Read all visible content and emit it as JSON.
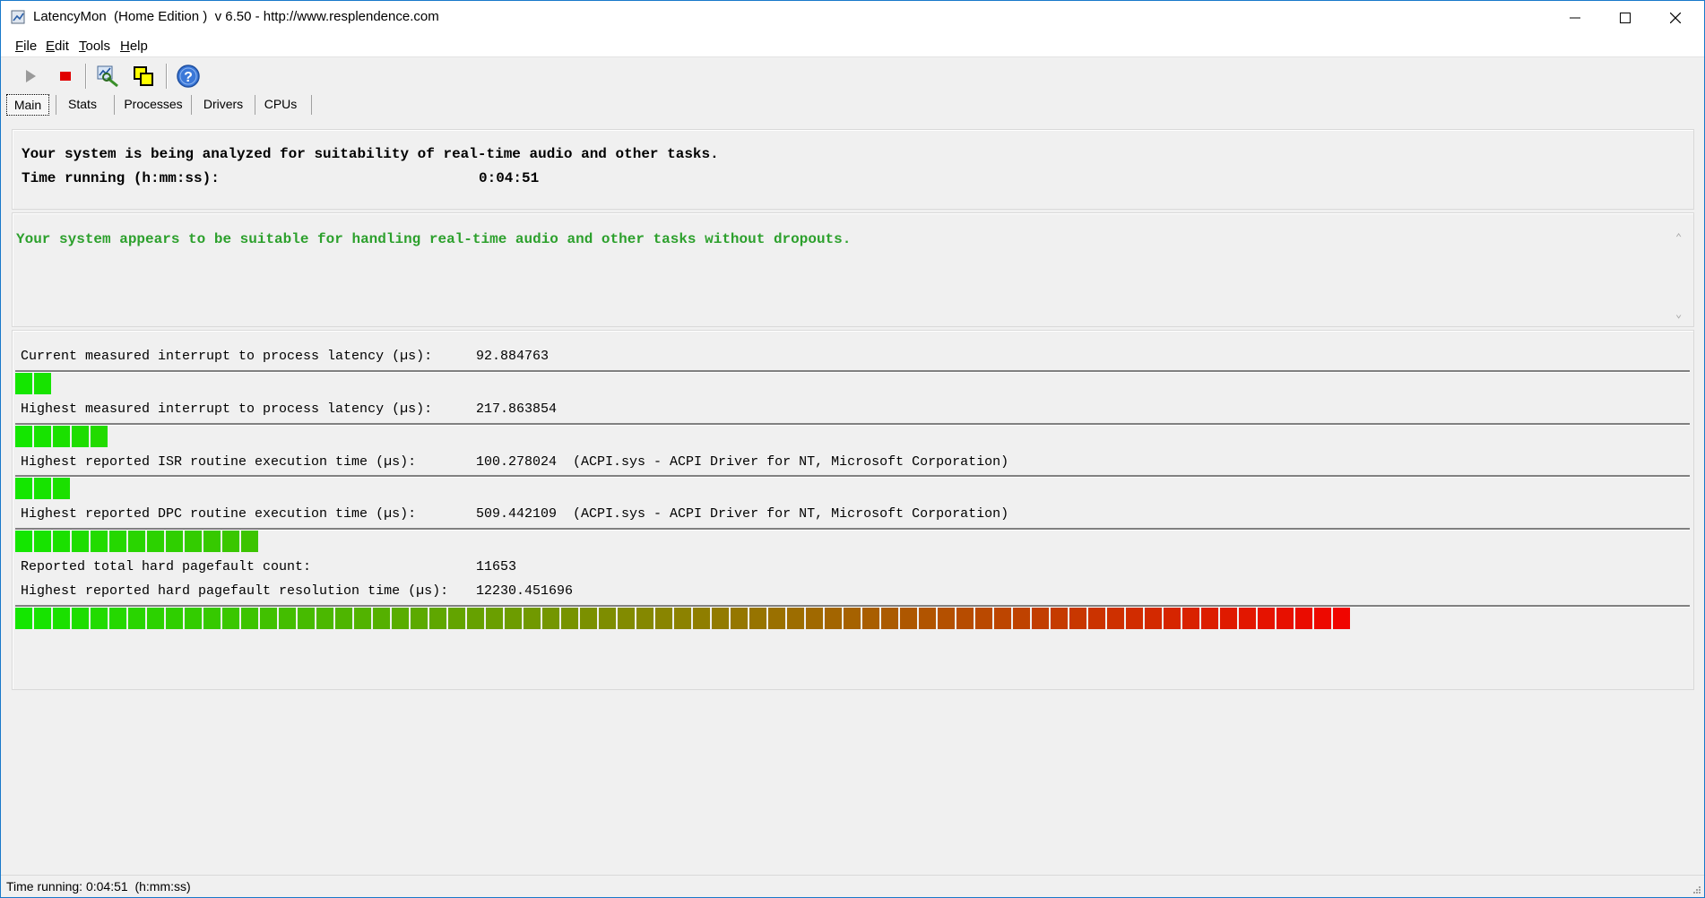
{
  "window": {
    "title": "LatencyMon  (Home Edition )  v 6.50 - http://www.resplendence.com"
  },
  "menu": {
    "items": [
      {
        "label": "File",
        "key": "F",
        "rest": "ile"
      },
      {
        "label": "Edit",
        "key": "E",
        "rest": "dit"
      },
      {
        "label": "Tools",
        "key": "T",
        "rest": "ools"
      },
      {
        "label": "Help",
        "key": "H",
        "rest": "elp"
      }
    ]
  },
  "toolbar": {
    "icons": [
      "play-icon",
      "stop-icon",
      "analyze-icon",
      "windows-icon",
      "help-icon"
    ]
  },
  "tabs": [
    {
      "label": "Main",
      "active": true
    },
    {
      "label": "Stats",
      "active": false
    },
    {
      "label": "Processes",
      "active": false
    },
    {
      "label": "Drivers",
      "active": false
    },
    {
      "label": "CPUs",
      "active": false
    }
  ],
  "summary": {
    "analyzing": "Your system is being analyzed for suitability of real-time audio and other tasks.",
    "time_label": "Time running (h:mm:ss):",
    "time_value": "0:04:51"
  },
  "verdict": {
    "message": "Your system appears to be suitable for handling real-time audio and other tasks without dropouts.",
    "color": "#2ca02c"
  },
  "metrics": [
    {
      "label": "Current measured interrupt to process latency (µs):",
      "value": "92.884763",
      "detail": "",
      "bar_segments": 2
    },
    {
      "label": "Highest measured interrupt to process latency (µs):",
      "value": "217.863854",
      "detail": "",
      "bar_segments": 5
    },
    {
      "label": "Highest reported ISR routine execution time (µs):",
      "value": "100.278024",
      "detail": "(ACPI.sys - ACPI Driver for NT, Microsoft Corporation)",
      "bar_segments": 3
    },
    {
      "label": "Highest reported DPC routine execution time (µs):",
      "value": "509.442109",
      "detail": "(ACPI.sys - ACPI Driver for NT, Microsoft Corporation)",
      "bar_segments": 13
    }
  ],
  "pagefault": {
    "count_label": "Reported total hard pagefault count:",
    "count_value": "11653",
    "time_label": "Highest reported hard pagefault resolution time (µs):",
    "time_value": "12230.451696",
    "bar_segments": 71
  },
  "status": {
    "text": "Time running: 0:04:51  (h:mm:ss)"
  }
}
